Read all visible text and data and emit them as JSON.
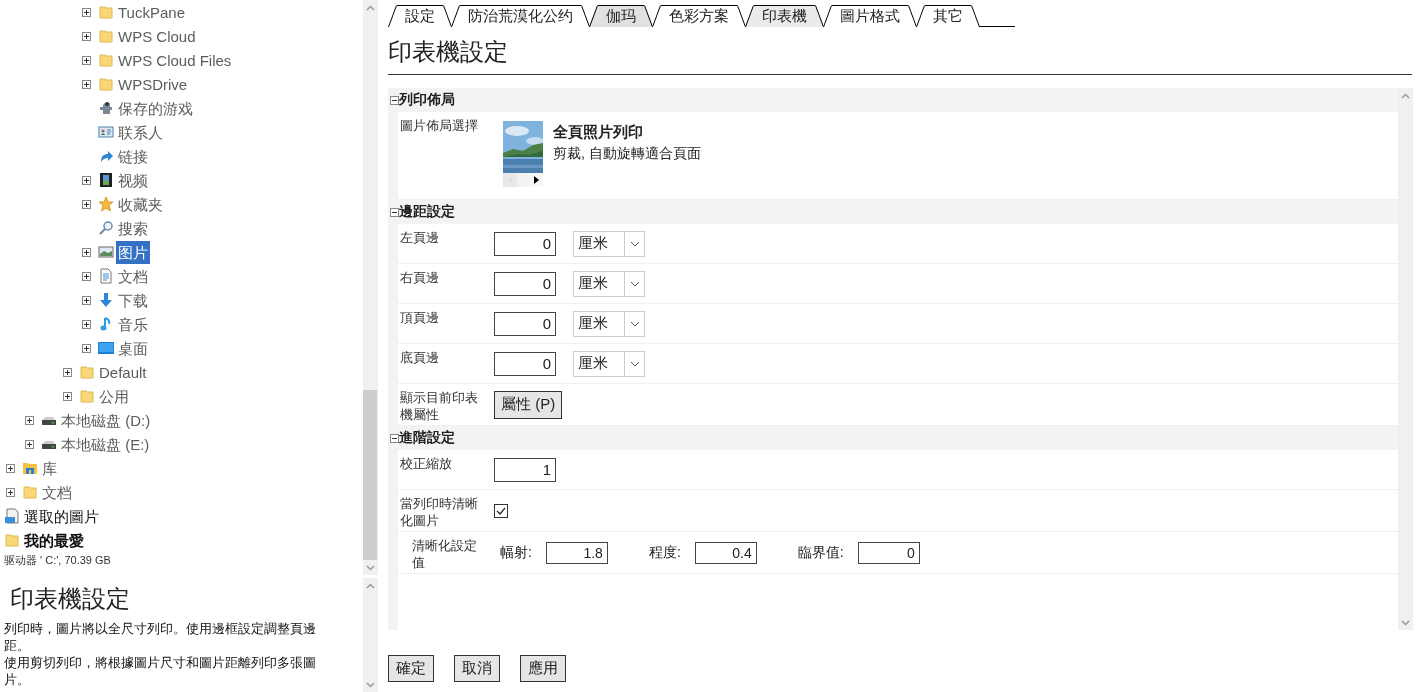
{
  "tree": [
    {
      "children": [
        {
          "children": [
            {
              "children": [
                {
                  "children": [
                    {
                      "label": "TuckPane",
                      "kind": "folder",
                      "expanded": false,
                      "selected": false
                    },
                    {
                      "label": "WPS Cloud",
                      "kind": "folder",
                      "expanded": false,
                      "selected": false
                    },
                    {
                      "label": "WPS Cloud Files",
                      "kind": "folder",
                      "expanded": false,
                      "selected": false
                    },
                    {
                      "label": "WPSDrive",
                      "kind": "folder",
                      "expanded": false,
                      "selected": false
                    },
                    {
                      "label": "保存的游戏",
                      "kind": "game",
                      "selected": false
                    },
                    {
                      "label": "联系人",
                      "kind": "contact",
                      "selected": false
                    },
                    {
                      "label": "链接",
                      "kind": "link",
                      "selected": false
                    },
                    {
                      "label": "视频",
                      "kind": "video",
                      "expanded": false,
                      "selected": false
                    },
                    {
                      "label": "收藏夹",
                      "kind": "star",
                      "expanded": false,
                      "selected": false
                    },
                    {
                      "label": "搜索",
                      "kind": "search",
                      "selected": false
                    },
                    {
                      "label": "图片",
                      "kind": "picture",
                      "expanded": false,
                      "selected": true
                    },
                    {
                      "label": "文档",
                      "kind": "document",
                      "expanded": false,
                      "selected": false
                    },
                    {
                      "label": "下载",
                      "kind": "download",
                      "expanded": false,
                      "selected": false
                    },
                    {
                      "label": "音乐",
                      "kind": "music",
                      "expanded": false,
                      "selected": false
                    },
                    {
                      "label": "桌面",
                      "kind": "desktop",
                      "expanded": false,
                      "selected": false
                    }
                  ]
                },
                {
                  "label": "Default",
                  "kind": "folder",
                  "expanded": false,
                  "selected": false
                },
                {
                  "label": "公用",
                  "kind": "folder",
                  "expanded": false,
                  "selected": false
                }
              ]
            }
          ]
        },
        {
          "label": "本地磁盘 (D:)",
          "kind": "drive",
          "expanded": false,
          "selected": false
        },
        {
          "label": "本地磁盘 (E:)",
          "kind": "drive",
          "expanded": false,
          "selected": false
        }
      ]
    },
    {
      "label": "库",
      "kind": "library",
      "expanded": false,
      "selected": false
    },
    {
      "label": "文档",
      "kind": "folder",
      "expanded": false,
      "selected": false
    }
  ],
  "pinned": [
    {
      "label": "選取的圖片",
      "kind": "picture-doc",
      "emphasized": false
    },
    {
      "label": "我的最愛",
      "kind": "folder",
      "emphasized": true
    }
  ],
  "drive_info": "驱动器 ' C:', 70.39 GB",
  "description": {
    "title": "印表機設定",
    "paragraphs": [
      "列印時，圖片將以全尺寸列印。使用邊框設定調整頁邊距。",
      "使用剪切列印，將根據圖片尺寸和圖片距離列印多張圖片。"
    ]
  },
  "tabs": [
    {
      "label": "設定",
      "selected": false,
      "hovered": false
    },
    {
      "label": "防治荒漠化公约",
      "selected": false,
      "hovered": false
    },
    {
      "label": "伽玛",
      "selected": true,
      "hovered": false
    },
    {
      "label": "色彩方案",
      "selected": false,
      "hovered": false
    },
    {
      "label": "印表機",
      "selected": false,
      "hovered": true
    },
    {
      "label": "圖片格式",
      "selected": false,
      "hovered": false
    },
    {
      "label": "其它",
      "selected": false,
      "hovered": false
    }
  ],
  "page_title": "印表機設定",
  "sections": [
    {
      "title": "列印佈局",
      "expanded": true,
      "rows": [
        {
          "kind": "layout",
          "label": "圖片佈局選擇",
          "option_title": "全頁照片列印",
          "option_detail": "剪裁, 自動旋轉適合頁面"
        }
      ]
    },
    {
      "title": "邊距設定",
      "expanded": true,
      "rows": [
        {
          "kind": "measure",
          "label": "左頁邊",
          "value": "0",
          "unit": "厘米"
        },
        {
          "kind": "measure",
          "label": "右頁邊",
          "value": "0",
          "unit": "厘米"
        },
        {
          "kind": "measure",
          "label": "頂頁邊",
          "value": "0",
          "unit": "厘米"
        },
        {
          "kind": "measure",
          "label": "底頁邊",
          "value": "0",
          "unit": "厘米"
        },
        {
          "kind": "button",
          "label": "顯示目前印表機屬性",
          "button": "屬性 (P)"
        }
      ]
    },
    {
      "title": "進階設定",
      "expanded": true,
      "rows": [
        {
          "kind": "number",
          "label": "校正縮放",
          "value": "1"
        },
        {
          "kind": "checkbox",
          "label": "當列印時清晰化圖片",
          "checked": true,
          "children": [
            {
              "kind": "fields",
              "label": "清晰化設定值",
              "fields": [
                {
                  "label": "幅射:",
                  "value": "1.8"
                },
                {
                  "label": "程度:",
                  "value": "0.4"
                },
                {
                  "label": "臨界值:",
                  "value": "0"
                }
              ]
            }
          ]
        }
      ]
    }
  ],
  "buttons": [
    "確定",
    "取消",
    "應用"
  ]
}
